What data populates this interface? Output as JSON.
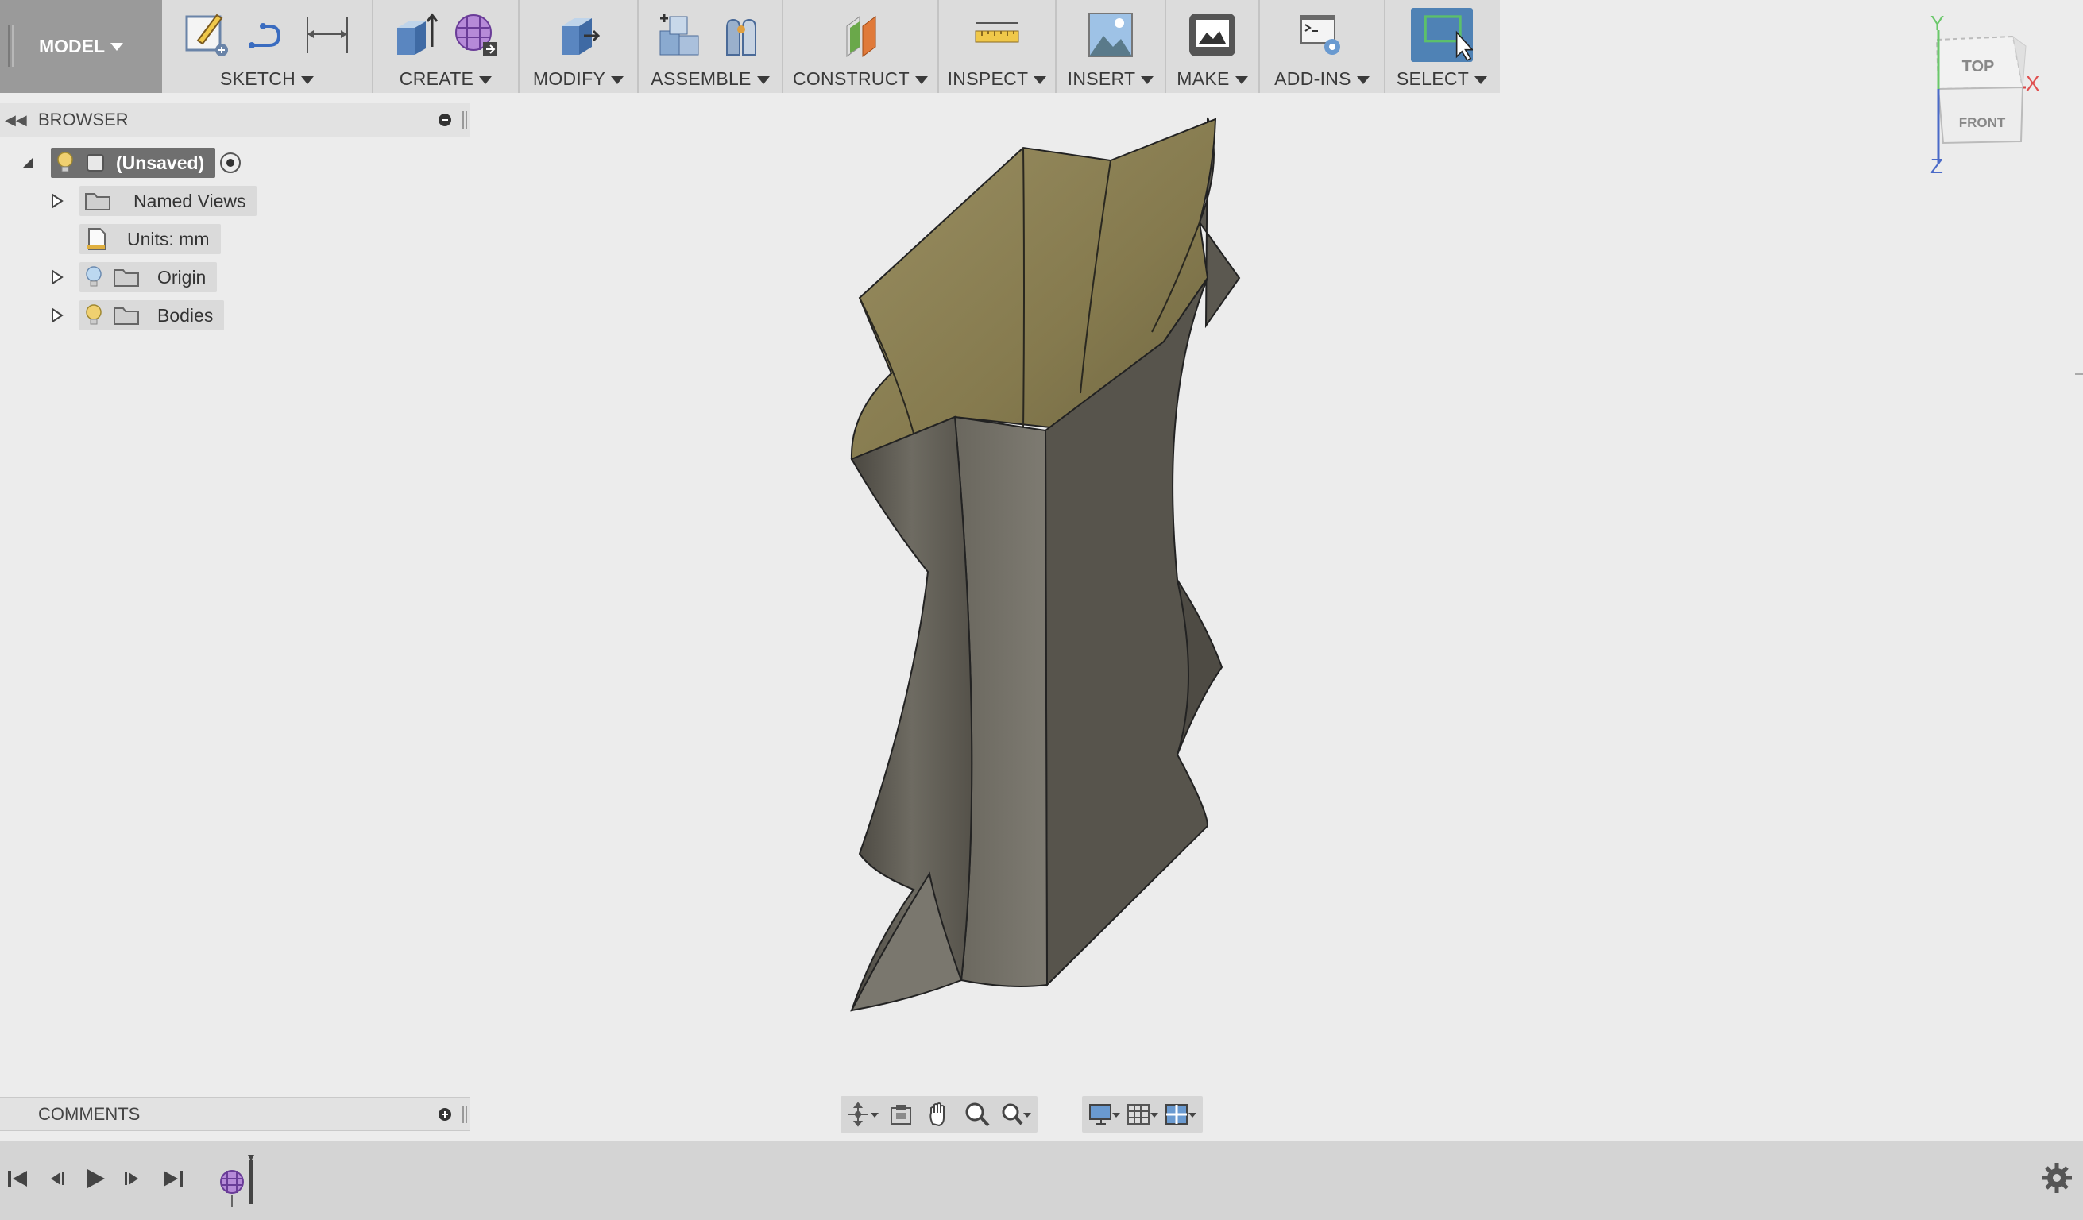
{
  "toolbar": {
    "model_label": "MODEL",
    "groups": [
      {
        "label": "SKETCH"
      },
      {
        "label": "CREATE"
      },
      {
        "label": "MODIFY"
      },
      {
        "label": "ASSEMBLE"
      },
      {
        "label": "CONSTRUCT"
      },
      {
        "label": "INSPECT"
      },
      {
        "label": "INSERT"
      },
      {
        "label": "MAKE"
      },
      {
        "label": "ADD-INS"
      },
      {
        "label": "SELECT"
      }
    ]
  },
  "browser": {
    "title": "BROWSER",
    "root": "(Unsaved)",
    "items": [
      {
        "label": "Named Views"
      },
      {
        "label": "Units: mm"
      },
      {
        "label": "Origin"
      },
      {
        "label": "Bodies"
      }
    ]
  },
  "comments": {
    "title": "COMMENTS"
  },
  "viewcube": {
    "top": "TOP",
    "front": "FRONT",
    "x": "X",
    "y": "Y",
    "z": "Z"
  },
  "colors": {
    "accent": "#4f82b5",
    "model_inside": "#8a7e54",
    "model_outside": "#5a564c"
  }
}
